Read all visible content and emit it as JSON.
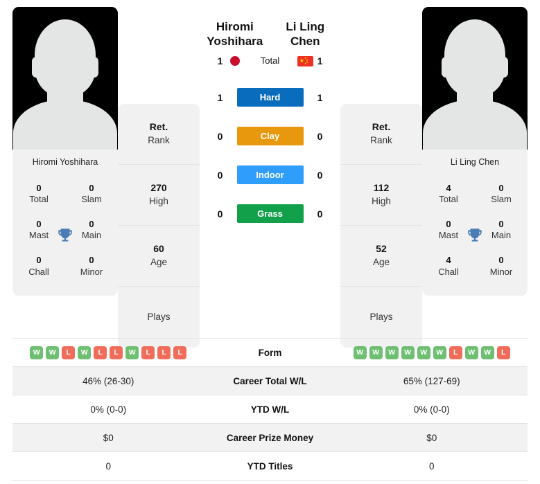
{
  "players": {
    "left": {
      "name": "Hiromi Yoshihara",
      "display_name_line1": "Hiromi",
      "display_name_line2": "Yoshihara",
      "flag": "japan-flag",
      "titles": [
        {
          "value": "0",
          "label": "Total"
        },
        {
          "value": "0",
          "label": "Slam"
        },
        {
          "value": "0",
          "label": "Mast"
        },
        {
          "value": "0",
          "label": "Main"
        },
        {
          "value": "0",
          "label": "Chall"
        },
        {
          "value": "0",
          "label": "Minor"
        }
      ],
      "info": [
        {
          "value": "Ret.",
          "label": "Rank"
        },
        {
          "value": "270",
          "label": "High"
        },
        {
          "value": "60",
          "label": "Age"
        },
        {
          "value": "",
          "label": "Plays"
        }
      ],
      "form": [
        "W",
        "W",
        "L",
        "W",
        "L",
        "L",
        "W",
        "L",
        "L",
        "L"
      ],
      "career_total_wl": "46% (26-30)",
      "ytd_wl": "0% (0-0)",
      "career_prize_money": "$0",
      "ytd_titles": "0"
    },
    "right": {
      "name": "Li Ling Chen",
      "display_name_line1": "Li Ling Chen",
      "display_name_line2": "",
      "flag": "china-flag",
      "titles": [
        {
          "value": "4",
          "label": "Total"
        },
        {
          "value": "0",
          "label": "Slam"
        },
        {
          "value": "0",
          "label": "Mast"
        },
        {
          "value": "0",
          "label": "Main"
        },
        {
          "value": "4",
          "label": "Chall"
        },
        {
          "value": "0",
          "label": "Minor"
        }
      ],
      "info": [
        {
          "value": "Ret.",
          "label": "Rank"
        },
        {
          "value": "112",
          "label": "High"
        },
        {
          "value": "52",
          "label": "Age"
        },
        {
          "value": "",
          "label": "Plays"
        }
      ],
      "form": [
        "W",
        "W",
        "W",
        "W",
        "W",
        "W",
        "L",
        "W",
        "W",
        "L"
      ],
      "career_total_wl": "65% (127-69)",
      "ytd_wl": "0% (0-0)",
      "career_prize_money": "$0",
      "ytd_titles": "0"
    }
  },
  "h2h": {
    "rows": [
      {
        "label": "Total",
        "left": "1",
        "right": "1",
        "color": "",
        "style": "plain"
      },
      {
        "label": "Hard",
        "left": "1",
        "right": "1",
        "color": "#0a6cbd",
        "style": "chip"
      },
      {
        "label": "Clay",
        "left": "0",
        "right": "0",
        "color": "#e8980c",
        "style": "chip"
      },
      {
        "label": "Indoor",
        "left": "0",
        "right": "0",
        "color": "#2f9dfb",
        "style": "chip"
      },
      {
        "label": "Grass",
        "left": "0",
        "right": "0",
        "color": "#12a04a",
        "style": "chip"
      }
    ]
  },
  "stats_rows": [
    {
      "label": "Form",
      "type": "form",
      "left": "",
      "right": ""
    },
    {
      "label": "Career Total W/L",
      "type": "text",
      "left": "46% (26-30)",
      "right": "65% (127-69)"
    },
    {
      "label": "YTD W/L",
      "type": "text",
      "left": "0% (0-0)",
      "right": "0% (0-0)"
    },
    {
      "label": "Career Prize Money",
      "type": "text",
      "left": "$0",
      "right": "$0"
    },
    {
      "label": "YTD Titles",
      "type": "text",
      "left": "0",
      "right": "0"
    }
  ],
  "colors": {
    "win": "#6fbf73",
    "loss": "#ef6d5a",
    "card_bg": "#f1f1f1",
    "row_shade": "#f2f2f2",
    "trophy": "#4a7cb5"
  }
}
